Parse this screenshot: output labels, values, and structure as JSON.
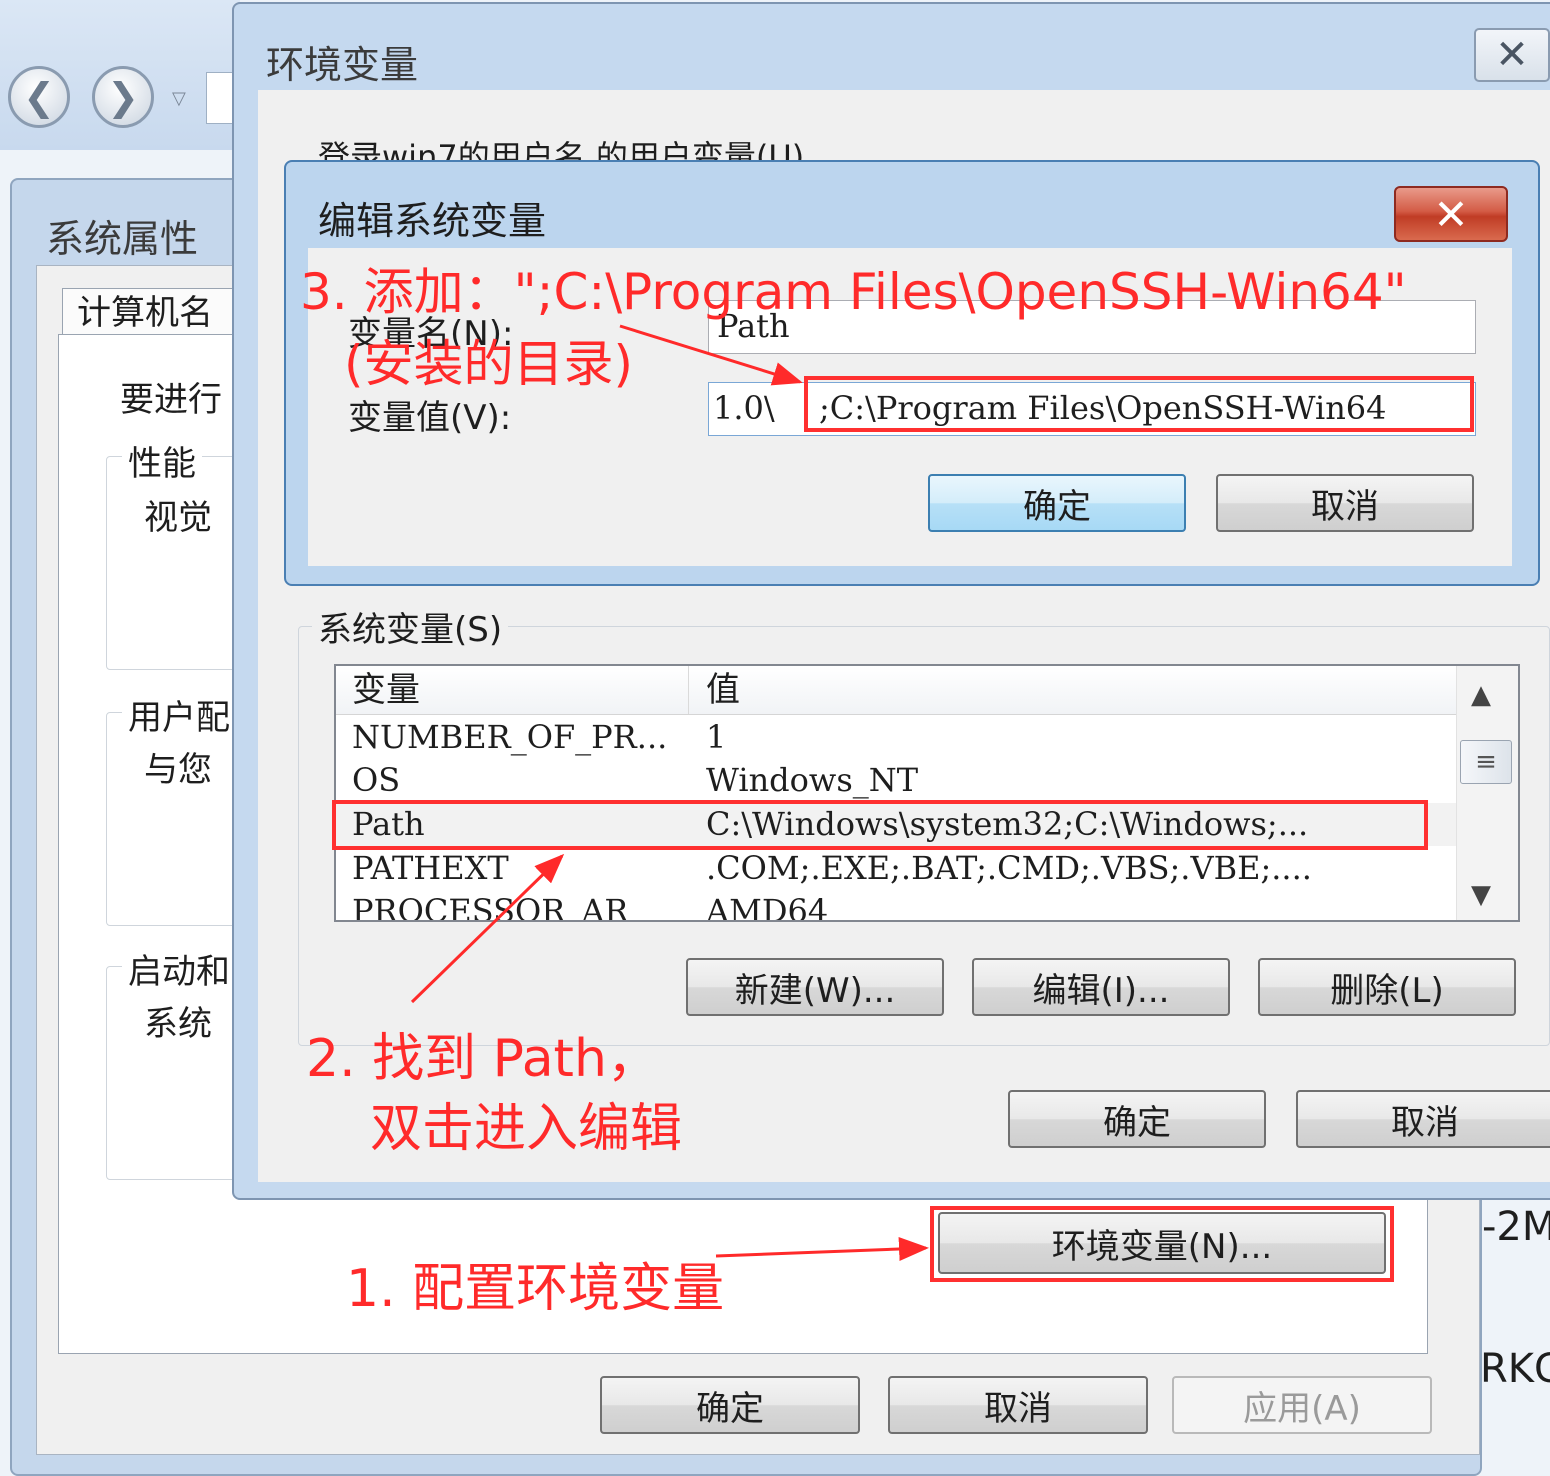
{
  "explorer": {
    "back_glyph": "❮",
    "forward_glyph": "❯",
    "dropdown_glyph": "▽"
  },
  "system_properties": {
    "title": "系统属性",
    "tab_label": "计算机名",
    "intro_text": "要进行",
    "groups": [
      {
        "label": "性能",
        "desc": "视觉"
      },
      {
        "label": "用户配",
        "desc": "与您"
      },
      {
        "label": "启动和",
        "desc": "系统"
      }
    ],
    "env_button_label": "环境变量(N)...",
    "ok_label": "确定",
    "cancel_label": "取消",
    "apply_label": "应用(A)"
  },
  "environment_variables": {
    "title": "环境变量",
    "close_glyph": "✕",
    "user_vars_label": "登录win7的用户名 的用户变量(U)",
    "system_vars_label": "系统变量(S)",
    "columns": [
      "变量",
      "值"
    ],
    "rows": [
      {
        "name": "NUMBER_OF_PR...",
        "value": "1"
      },
      {
        "name": "OS",
        "value": "Windows_NT"
      },
      {
        "name": "Path",
        "value": "C:\\Windows\\system32;C:\\Windows;..."
      },
      {
        "name": "PATHEXT",
        "value": ".COM;.EXE;.BAT;.CMD;.VBS;.VBE;...."
      },
      {
        "name": "PROCESSOR_AR",
        "value": "AMD64"
      }
    ],
    "new_label": "新建(W)...",
    "edit_label": "编辑(I)...",
    "delete_label": "删除(L)",
    "ok_label": "确定",
    "cancel_label": "取消",
    "scroll_up_glyph": "▲",
    "scroll_down_glyph": "▼",
    "scroll_thumb_glyph": "≡"
  },
  "edit_dialog": {
    "title": "编辑系统变量",
    "close_glyph": "✕",
    "name_label": "变量名(N):",
    "value_label": "变量值(V):",
    "name_value": "Path",
    "value_prefix": "1.0\\",
    "value_suffix": ";C:\\Program Files\\OpenSSH-Win64",
    "ok_label": "确定",
    "cancel_label": "取消"
  },
  "annotations": {
    "step1": "1. 配置环境变量",
    "step2_line1": "2. 找到 Path，",
    "step2_line2": "双击进入编辑",
    "step3_line1": "3. 添加：\";C:\\Program Files\\OpenSSH-Win64\"",
    "step3_line2": "(安装的目录)",
    "color": "#ff2a2a"
  },
  "background_clips": {
    "right_text_1": "-2M",
    "right_text_2": "RKG"
  }
}
